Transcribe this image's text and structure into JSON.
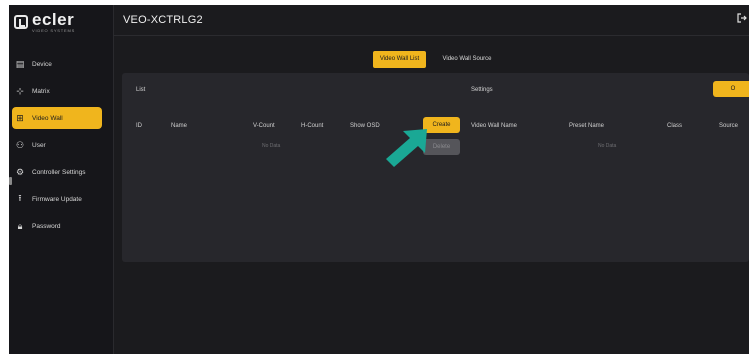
{
  "brand": {
    "name": "ecler",
    "sub": "VIDEO SYSTEMS"
  },
  "header": {
    "title": "VEO-XCTRLG2",
    "icon": "logout-icon"
  },
  "sidebar": {
    "items": [
      {
        "label": "Device",
        "icon": "device-icon",
        "glyph": "▤"
      },
      {
        "label": "Matrix",
        "icon": "matrix-icon",
        "glyph": "⊹"
      },
      {
        "label": "Video Wall",
        "icon": "grid-icon",
        "glyph": "⊞"
      },
      {
        "label": "User",
        "icon": "user-icon",
        "glyph": "⚇"
      },
      {
        "label": "Controller Settings",
        "icon": "gear-icon",
        "glyph": "⚙"
      },
      {
        "label": "Firmware Update",
        "icon": "upload-icon",
        "glyph": "⭱"
      },
      {
        "label": "Password",
        "icon": "lock-icon",
        "glyph": "🔒︎"
      }
    ],
    "active_index": 2
  },
  "tabs": {
    "list": "Video Wall List",
    "source": "Video Wall Source"
  },
  "panel": {
    "list_label": "List",
    "settings_label": "Settings",
    "top_button": "O",
    "columns_left": [
      "ID",
      "Name",
      "V-Count",
      "H-Count",
      "Show OSD"
    ],
    "columns_right": [
      "Video Wall Name",
      "Preset Name",
      "Class",
      "Source"
    ],
    "create_button": "Create",
    "disabled_button": "Delete",
    "no_data_left": "No Data",
    "no_data_right": "No Data"
  },
  "colors": {
    "accent": "#f0b51d",
    "arrow": "#1aa895",
    "background": "#1b1b1e",
    "panel": "#27272c"
  }
}
